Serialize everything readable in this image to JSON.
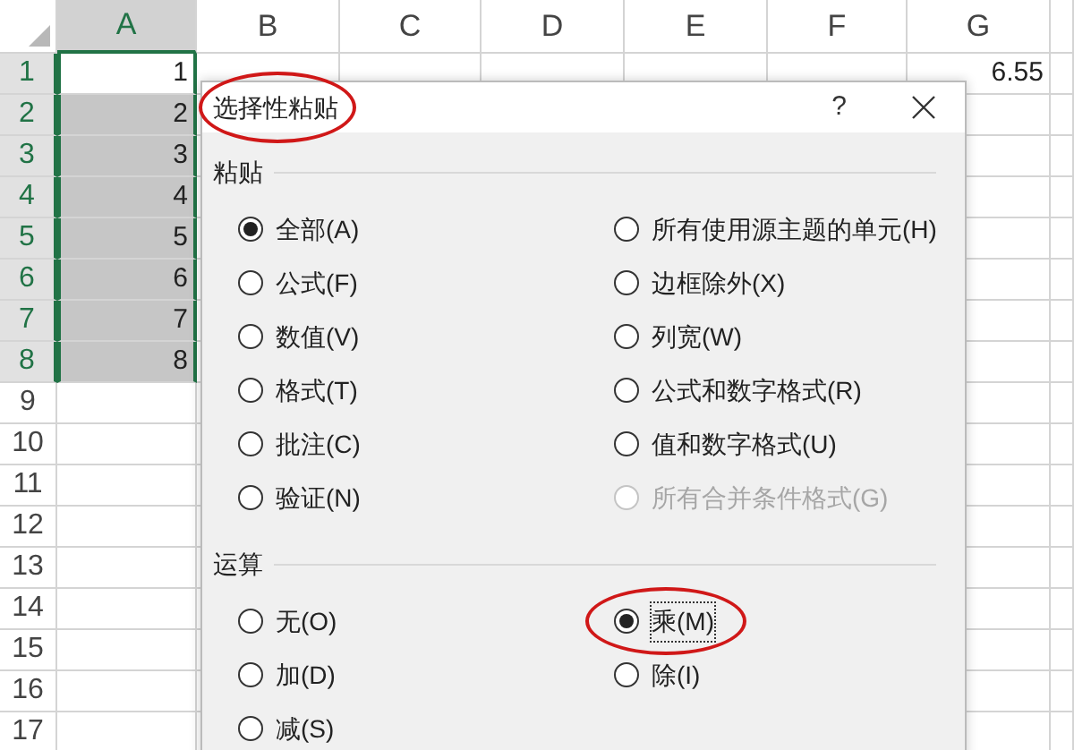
{
  "sheet": {
    "columns": [
      {
        "label": "A",
        "selected": true
      },
      {
        "label": "B",
        "selected": false
      },
      {
        "label": "C",
        "selected": false
      },
      {
        "label": "D",
        "selected": false
      },
      {
        "label": "E",
        "selected": false
      },
      {
        "label": "F",
        "selected": false
      },
      {
        "label": "G",
        "selected": false
      }
    ],
    "rows": [
      {
        "header": "1",
        "selected": true,
        "active": true,
        "cells": [
          "1",
          null,
          null,
          null,
          null,
          null,
          "6.55"
        ]
      },
      {
        "header": "2",
        "selected": true,
        "active": false,
        "cells": [
          "2"
        ]
      },
      {
        "header": "3",
        "selected": true,
        "active": false,
        "cells": [
          "3"
        ]
      },
      {
        "header": "4",
        "selected": true,
        "active": false,
        "cells": [
          "4"
        ]
      },
      {
        "header": "5",
        "selected": true,
        "active": false,
        "cells": [
          "5"
        ]
      },
      {
        "header": "6",
        "selected": true,
        "active": false,
        "cells": [
          "6"
        ]
      },
      {
        "header": "7",
        "selected": true,
        "active": false,
        "cells": [
          "7"
        ]
      },
      {
        "header": "8",
        "selected": true,
        "active": false,
        "cells": [
          "8"
        ]
      },
      {
        "header": "9",
        "selected": false
      },
      {
        "header": "10",
        "selected": false
      },
      {
        "header": "11",
        "selected": false
      },
      {
        "header": "12",
        "selected": false
      },
      {
        "header": "13",
        "selected": false
      },
      {
        "header": "14",
        "selected": false
      },
      {
        "header": "15",
        "selected": false
      },
      {
        "header": "16",
        "selected": false
      },
      {
        "header": "17",
        "selected": false
      }
    ]
  },
  "dialog": {
    "title": "选择性粘贴",
    "title_highlighted": true,
    "help": "?",
    "sections": [
      {
        "label": "粘贴",
        "options": [
          {
            "label": "全部(A)",
            "selected": true,
            "disabled": false,
            "focused": false,
            "highlighted": false
          },
          {
            "label": "所有使用源主题的单元(H)",
            "selected": false,
            "disabled": false,
            "focused": false,
            "highlighted": false
          },
          {
            "label": "公式(F)",
            "selected": false,
            "disabled": false,
            "focused": false,
            "highlighted": false
          },
          {
            "label": "边框除外(X)",
            "selected": false,
            "disabled": false,
            "focused": false,
            "highlighted": false
          },
          {
            "label": "数值(V)",
            "selected": false,
            "disabled": false,
            "focused": false,
            "highlighted": false
          },
          {
            "label": "列宽(W)",
            "selected": false,
            "disabled": false,
            "focused": false,
            "highlighted": false
          },
          {
            "label": "格式(T)",
            "selected": false,
            "disabled": false,
            "focused": false,
            "highlighted": false
          },
          {
            "label": "公式和数字格式(R)",
            "selected": false,
            "disabled": false,
            "focused": false,
            "highlighted": false
          },
          {
            "label": "批注(C)",
            "selected": false,
            "disabled": false,
            "focused": false,
            "highlighted": false
          },
          {
            "label": "值和数字格式(U)",
            "selected": false,
            "disabled": false,
            "focused": false,
            "highlighted": false
          },
          {
            "label": "验证(N)",
            "selected": false,
            "disabled": false,
            "focused": false,
            "highlighted": false
          },
          {
            "label": "所有合并条件格式(G)",
            "selected": false,
            "disabled": true,
            "focused": false,
            "highlighted": false
          }
        ]
      },
      {
        "label": "运算",
        "options": [
          {
            "label": "无(O)",
            "selected": false,
            "disabled": false,
            "focused": false,
            "highlighted": false
          },
          {
            "label": "乘(M)",
            "selected": true,
            "disabled": false,
            "focused": true,
            "highlighted": true
          },
          {
            "label": "加(D)",
            "selected": false,
            "disabled": false,
            "focused": false,
            "highlighted": false
          },
          {
            "label": "除(I)",
            "selected": false,
            "disabled": false,
            "focused": false,
            "highlighted": false
          },
          {
            "label": "减(S)",
            "selected": false,
            "disabled": false,
            "focused": false,
            "highlighted": false
          }
        ]
      }
    ]
  }
}
